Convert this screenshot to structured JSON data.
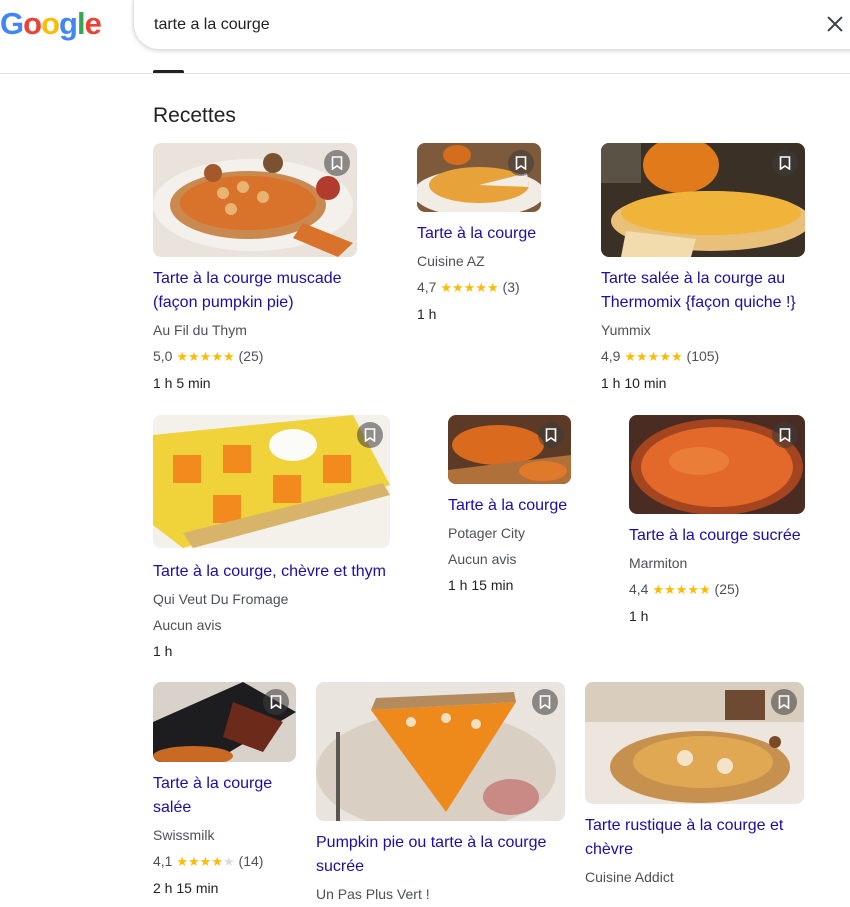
{
  "search": {
    "query": "tarte a la courge"
  },
  "section": {
    "title": "Recettes"
  },
  "recipes": [
    {
      "title_line1": "Tarte à la courge muscade",
      "title_line2": "(façon pumpkin pie)",
      "source": "Au Fil du Thym",
      "rating": "5,0",
      "stars": "★★★★★",
      "stars_empty": "",
      "reviews": "(25)",
      "time": "1 h 5 min"
    },
    {
      "title_line1": "Tarte à la courge",
      "title_line2": "",
      "source": "Cuisine AZ",
      "rating": "4,7",
      "stars": "★★★★★",
      "stars_empty": "",
      "reviews": "(3)",
      "time": "1 h"
    },
    {
      "title_line1": "Tarte salée à la courge au",
      "title_line2": "Thermomix {façon quiche !}",
      "source": "Yummix",
      "rating": "4,9",
      "stars": "★★★★★",
      "stars_empty": "",
      "reviews": "(105)",
      "time": "1 h 10 min"
    },
    {
      "title_line1": "Tarte à la courge, chèvre et thym",
      "title_line2": "",
      "source": "Qui Veut Du Fromage",
      "no_reviews": "Aucun avis",
      "time": "1 h"
    },
    {
      "title_line1": "Tarte à la courge",
      "title_line2": "",
      "source": "Potager City",
      "no_reviews": "Aucun avis",
      "time": "1 h 15 min"
    },
    {
      "title_line1": "Tarte à la courge sucrée",
      "title_line2": "",
      "source": "Marmiton",
      "rating": "4,4",
      "stars": "★★★★★",
      "stars_empty": "",
      "reviews": "(25)",
      "time": "1 h"
    },
    {
      "title_line1": "Tarte à la courge",
      "title_line2": "salée",
      "source": "Swissmilk",
      "rating": "4,1",
      "stars": "★★★★",
      "stars_empty": "★",
      "reviews": "(14)",
      "time": "2 h 15 min"
    },
    {
      "title_line1": "Pumpkin pie ou tarte à la courge",
      "title_line2": "sucrée",
      "source": "Un Pas Plus Vert !"
    },
    {
      "title_line1": "Tarte rustique à la courge et",
      "title_line2": "chèvre",
      "source": "Cuisine Addict"
    }
  ],
  "colors": {
    "link": "#1a0dab",
    "star": "#fbbc04",
    "text": "#202124",
    "meta": "#4d5156"
  },
  "icons": {
    "clear": "close-icon",
    "bookmark": "bookmark-icon"
  }
}
